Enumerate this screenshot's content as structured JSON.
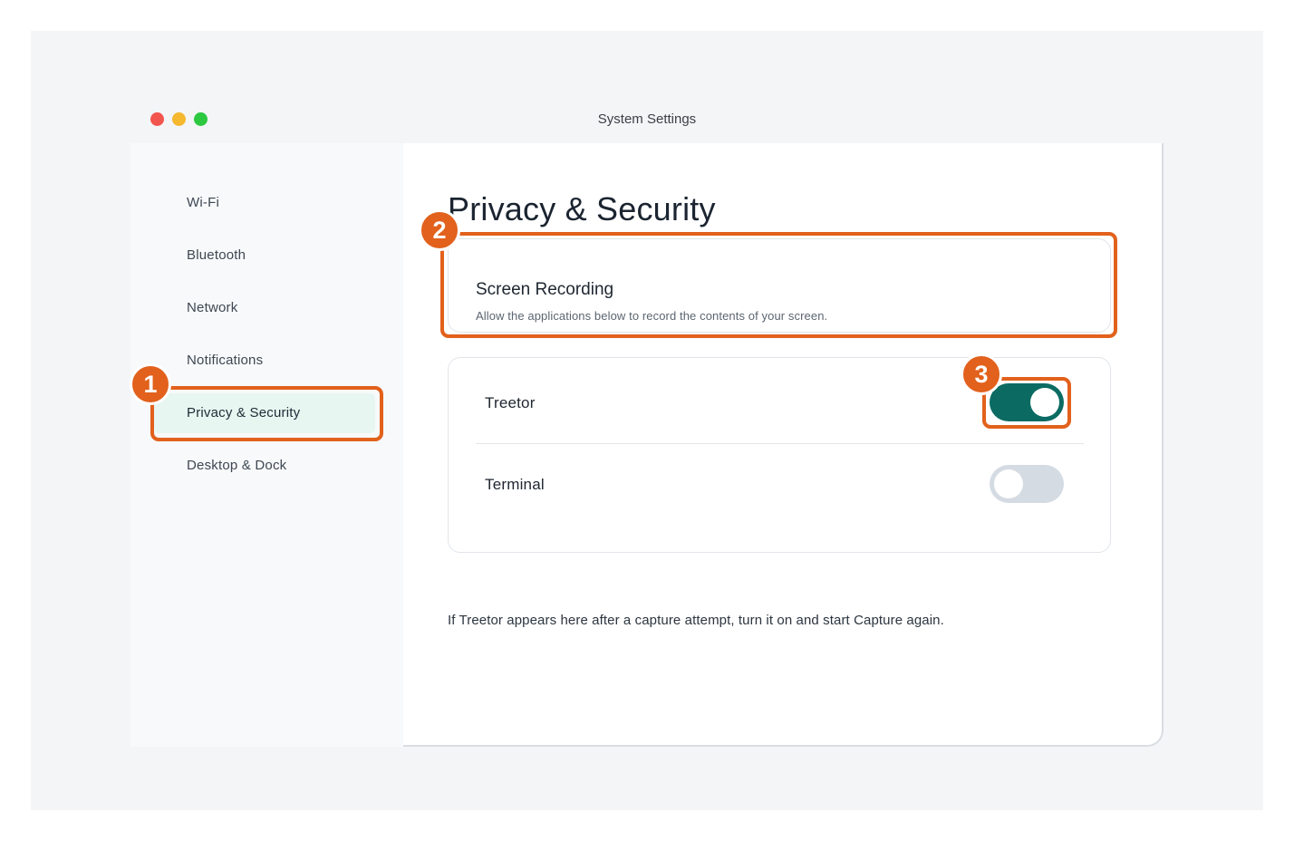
{
  "window": {
    "title": "System Settings",
    "traffic_lights": [
      {
        "name": "close",
        "color": "#f2544e"
      },
      {
        "name": "minimize",
        "color": "#f5b82e"
      },
      {
        "name": "zoom",
        "color": "#2bc840"
      }
    ]
  },
  "sidebar": {
    "items": [
      {
        "label": "Wi-Fi",
        "active": false
      },
      {
        "label": "Bluetooth",
        "active": false
      },
      {
        "label": "Network",
        "active": false
      },
      {
        "label": "Notifications",
        "active": false
      },
      {
        "label": "Privacy & Security",
        "active": true
      },
      {
        "label": "Desktop & Dock",
        "active": false
      }
    ]
  },
  "main": {
    "title": "Privacy & Security",
    "section": {
      "title": "Screen Recording",
      "description": "Allow the applications below to record the contents of your screen."
    },
    "apps": [
      {
        "name": "Treetor",
        "enabled": true
      },
      {
        "name": "Terminal",
        "enabled": false
      }
    ],
    "hint": "If Treetor appears here after a capture attempt, turn it on and start Capture again."
  },
  "annotations": {
    "color": "#e2611c",
    "steps": [
      "1",
      "2",
      "3"
    ]
  },
  "colors": {
    "accent": "#0b6b63",
    "active_item_bg": "#e7f6f0",
    "toggle_off": "#d5dbe3"
  }
}
